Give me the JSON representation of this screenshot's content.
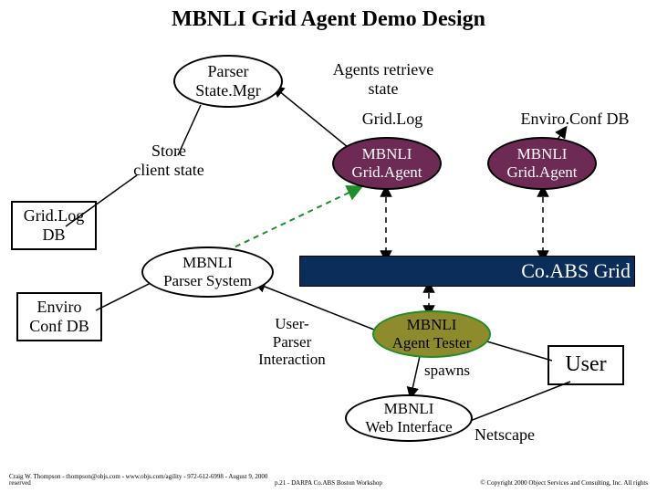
{
  "title": "MBNLI Grid Agent Demo Design",
  "colors": {
    "maroon_fill": "#6d2a55",
    "maroon_stroke": "#000000",
    "olive_fill": "#8e8b2d",
    "green_stroke": "#1f8d2a",
    "coabs_bar": "#0a2d5a"
  },
  "labels": {
    "parser_statemgr": "Parser\nState.Mgr",
    "agents_retrieve_state": "Agents retrieve\nstate",
    "gridlog": "Grid.Log",
    "enviroconf_db_top": "Enviro.Conf DB",
    "store_client_state": "Store\nclient state",
    "gridlog_db": "Grid.Log\nDB",
    "enviro_conf_db_left": "Enviro\nConf DB",
    "parser_system": "MBNLI\nParser System",
    "user_parser_interaction": "User-\nParser\nInteraction",
    "grid_agent_left": "MBNLI\nGrid.Agent",
    "grid_agent_right": "MBNLI\nGrid.Agent",
    "agent_tester": "MBNLI\nAgent Tester",
    "web_interface": "MBNLI\nWeb Interface",
    "spawns": "spawns",
    "user": "User",
    "netscape": "Netscape",
    "coabs_grid": "Co.ABS Grid"
  },
  "footer": {
    "left": "Craig W. Thompson - thompson@objs.com - www.objs.com/agility - 972-612-6998 - August 9, 2000  reserved",
    "center": "p.21 - DARPA Co.ABS Boston Workshop",
    "right": "© Copyright 2000 Object Services and Consulting, Inc. All rights"
  }
}
